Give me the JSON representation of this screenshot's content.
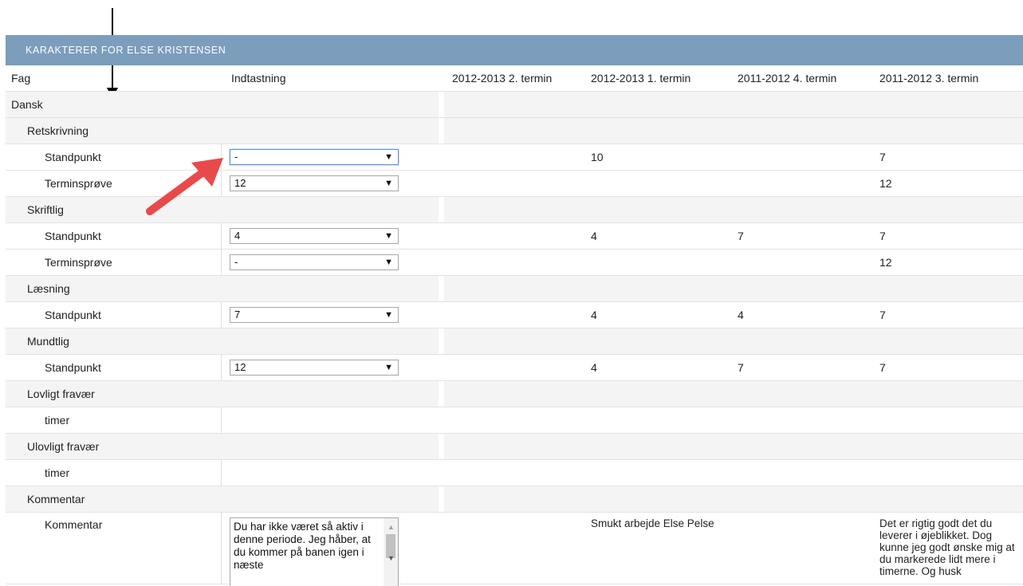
{
  "panel": {
    "title": "KARAKTERER FOR ELSE KRISTENSEN"
  },
  "columns": {
    "fag": "Fag",
    "indtastning": "Indtastning",
    "t0": "2012-2013 2. termin",
    "t1": "2012-2013 1. termin",
    "t2": "2011-2012 4. termin",
    "t3": "2011-2012 3. termin"
  },
  "subject": "Dansk",
  "sections": {
    "retskrivning": {
      "label": "Retskrivning",
      "standpunkt": {
        "label": "Standpunkt",
        "value": "-",
        "t1": "10",
        "t2": "",
        "t3": "7"
      },
      "terminsprove": {
        "label": "Terminsprøve",
        "value": "12",
        "t1": "",
        "t2": "",
        "t3": "12"
      }
    },
    "skriftlig": {
      "label": "Skriftlig",
      "standpunkt": {
        "label": "Standpunkt",
        "value": "4",
        "t1": "4",
        "t2": "7",
        "t3": "7"
      },
      "terminsprove": {
        "label": "Terminsprøve",
        "value": "-",
        "t1": "",
        "t2": "",
        "t3": "12"
      }
    },
    "laesning": {
      "label": "Læsning",
      "standpunkt": {
        "label": "Standpunkt",
        "value": "7",
        "t1": "4",
        "t2": "4",
        "t3": "7"
      }
    },
    "mundtlig": {
      "label": "Mundtlig",
      "standpunkt": {
        "label": "Standpunkt",
        "value": "12",
        "t1": "4",
        "t2": "7",
        "t3": "7"
      }
    },
    "lovligt": {
      "label": "Lovligt fravær",
      "sub": "timer"
    },
    "ulovligt": {
      "label": "Ulovligt fravær",
      "sub": "timer"
    },
    "kommentar": {
      "label": "Kommentar",
      "sub": "Kommentar",
      "text": "Du har ikke været så aktiv i denne periode. Jeg håber, at du kommer på banen igen i næste",
      "t1": "Smukt arbejde Else Pelse",
      "t3": "Det er rigtig godt det du leverer i øjeblikket. Dog kunne jeg godt ønske mig at du markerede lidt mere i timerne. Og husk"
    }
  },
  "colors": {
    "header": "#7c9dbc",
    "annotation_arrow": "#e84a4a"
  }
}
